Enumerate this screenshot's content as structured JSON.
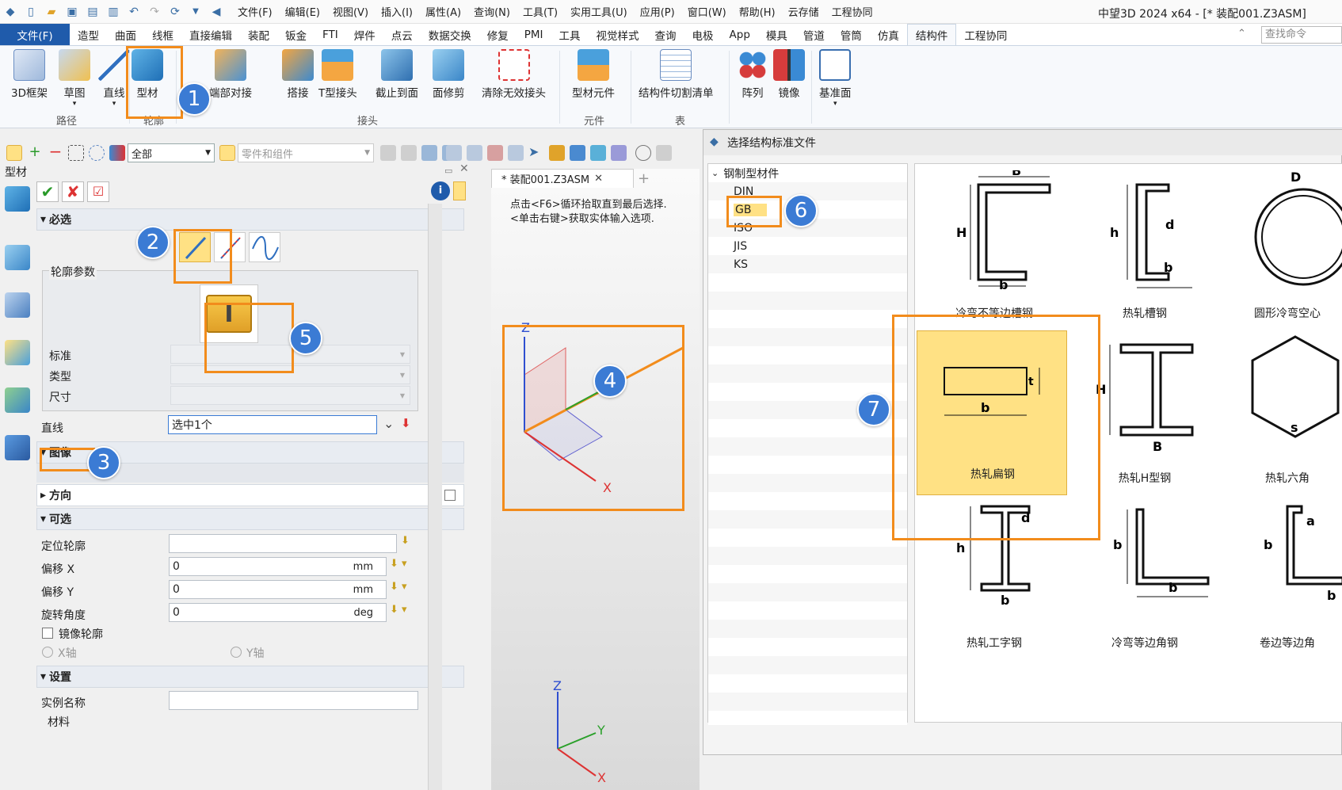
{
  "title_bar": {
    "menus": [
      "文件(F)",
      "编辑(E)",
      "视图(V)",
      "插入(I)",
      "属性(A)",
      "查询(N)",
      "工具(T)",
      "实用工具(U)",
      "应用(P)",
      "窗口(W)",
      "帮助(H)",
      "云存储",
      "工程协同"
    ],
    "app_title": "中望3D 2024 x64 - [* 装配001.Z3ASM]"
  },
  "ribbon_tabs": [
    "文件(F)",
    "造型",
    "曲面",
    "线框",
    "直接编辑",
    "装配",
    "钣金",
    "FTI",
    "焊件",
    "点云",
    "数据交换",
    "修复",
    "PMI",
    "工具",
    "视觉样式",
    "查询",
    "电极",
    "App",
    "模具",
    "管道",
    "管筒",
    "仿真",
    "结构件",
    "工程协同"
  ],
  "active_tab": "结构件",
  "search_placeholder": "查找命令",
  "ribbon": {
    "buttons": [
      "3D框架",
      "草图",
      "直线",
      "型材",
      "端部对接",
      "搭接",
      "T型接头",
      "截止到面",
      "面修剪",
      "清除无效接头",
      "型材元件",
      "结构件切割清单",
      "阵列",
      "镜像",
      "基准面"
    ],
    "groups": [
      "路径",
      "轮廓",
      "接头",
      "元件",
      "表"
    ]
  },
  "toolbar": {
    "filter_value": "全部",
    "scope_value": "零件和组件"
  },
  "panel": {
    "title": "型材",
    "sections": {
      "required": "必选",
      "profile_params": "轮廓参数",
      "image": "图像",
      "direction": "方向",
      "optional": "可选",
      "settings": "设置"
    },
    "fields": {
      "standard_label": "标准",
      "type_label": "类型",
      "size_label": "尺寸",
      "line_label": "直线",
      "line_value": "选中1个",
      "locate_profile_label": "定位轮廓",
      "offset_x_label": "偏移 X",
      "offset_x_value": "0",
      "offset_x_unit": "mm",
      "offset_y_label": "偏移 Y",
      "offset_y_value": "0",
      "offset_y_unit": "mm",
      "rotation_label": "旋转角度",
      "rotation_value": "0",
      "rotation_unit": "deg",
      "mirror_label": "镜像轮廓",
      "x_axis_label": "X轴",
      "y_axis_label": "Y轴",
      "instance_label": "实例名称",
      "material_label": "材料"
    }
  },
  "viewport": {
    "doc_tab": "* 装配001.Z3ASM",
    "hint_line1": "点击<F6>循环拾取直到最后选择.",
    "hint_line2": "<单击右键>获取实体输入选项.",
    "axis_x": "X",
    "axis_y": "Y",
    "axis_z": "Z"
  },
  "dialog": {
    "title": "选择结构标准文件",
    "tree_root": "钢制型材件",
    "tree_items": [
      "DIN",
      "GB",
      "ISO",
      "JIS",
      "KS"
    ],
    "selected_item": "GB",
    "gallery": [
      "冷弯不等边槽钢",
      "热轧槽钢",
      "圆形冷弯空心",
      "热轧扁钢",
      "热轧H型钢",
      "热轧六角",
      "热轧工字钢",
      "冷弯等边角钢",
      "卷边等边角"
    ],
    "selected_gallery": "热轧扁钢"
  },
  "annotations": [
    "1",
    "2",
    "3",
    "4",
    "5",
    "6",
    "7"
  ],
  "colors": {
    "highlight": "#f28c1c",
    "badge": "#3b7bd4",
    "selection": "#ffe184",
    "file_tab": "#1f5bab"
  }
}
